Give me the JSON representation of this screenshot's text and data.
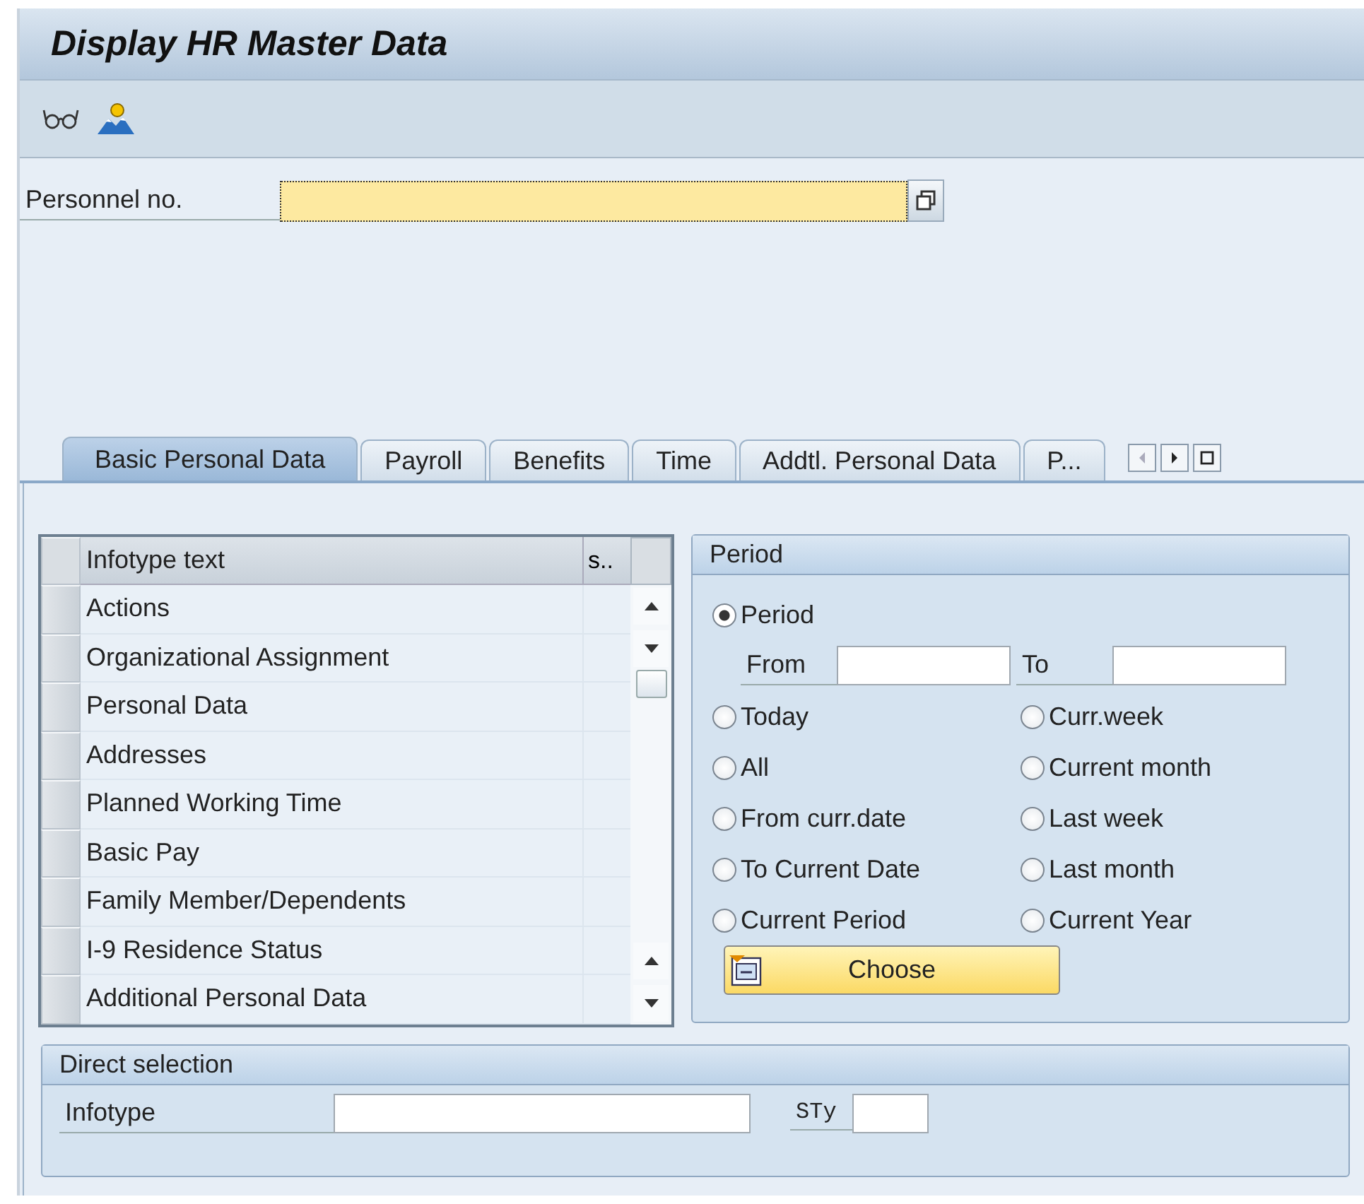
{
  "window": {
    "title": "Display HR Master Data"
  },
  "personnel": {
    "label": "Personnel no."
  },
  "tabs": [
    {
      "label": "Basic Personal Data",
      "selected": true
    },
    {
      "label": "Payroll",
      "selected": false
    },
    {
      "label": "Benefits",
      "selected": false
    },
    {
      "label": "Time",
      "selected": false
    },
    {
      "label": "Addtl. Personal Data",
      "selected": false
    },
    {
      "label": "P...",
      "selected": false
    }
  ],
  "table": {
    "columns": [
      "Infotype text",
      "s.."
    ],
    "rows": [
      "Actions",
      "Organizational Assignment",
      "Personal Data",
      "Addresses",
      "Planned Working Time",
      "Basic Pay",
      "Family Member/Dependents",
      "I-9 Residence Status",
      "Additional Personal Data"
    ]
  },
  "period": {
    "title": "Period",
    "from_label": "From",
    "to_label": "To",
    "options": [
      {
        "label": "Period",
        "selected": true
      },
      {
        "label": "Today",
        "selected": false
      },
      {
        "label": "Curr.week",
        "selected": false
      },
      {
        "label": "All",
        "selected": false
      },
      {
        "label": "Current month",
        "selected": false
      },
      {
        "label": "From curr.date",
        "selected": false
      },
      {
        "label": "Last week",
        "selected": false
      },
      {
        "label": "To Current Date",
        "selected": false
      },
      {
        "label": "Last month",
        "selected": false
      },
      {
        "label": "Current Period",
        "selected": false
      },
      {
        "label": "Current Year",
        "selected": false
      }
    ],
    "choose_button": "Choose"
  },
  "direct_selection": {
    "title": "Direct selection",
    "infotype_label": "Infotype",
    "subtype_label": "STy"
  }
}
